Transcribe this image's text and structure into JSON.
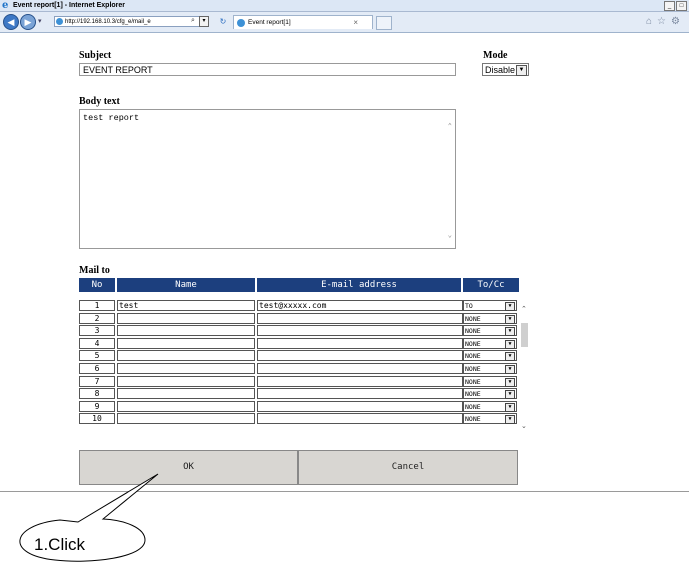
{
  "window": {
    "title": "Event report[1] - Internet Explorer",
    "address": "http://192.168.10.3/cfg_e/mail_e",
    "tab_label": "Event report[1]",
    "tab_close": "×"
  },
  "form": {
    "subject_label": "Subject",
    "subject_value": "EVENT REPORT",
    "mode_label": "Mode",
    "mode_value": "Disable",
    "body_label": "Body text",
    "body_value": "test report",
    "mail_to_label": "Mail to",
    "columns": [
      "No",
      "Name",
      "E-mail address",
      "To/Cc"
    ],
    "rows": [
      {
        "no": "1",
        "name": "test",
        "email": "test@xxxxx.com",
        "tocc": "TO"
      },
      {
        "no": "2",
        "name": "",
        "email": "",
        "tocc": "NONE"
      },
      {
        "no": "3",
        "name": "",
        "email": "",
        "tocc": "NONE"
      },
      {
        "no": "4",
        "name": "",
        "email": "",
        "tocc": "NONE"
      },
      {
        "no": "5",
        "name": "",
        "email": "",
        "tocc": "NONE"
      },
      {
        "no": "6",
        "name": "",
        "email": "",
        "tocc": "NONE"
      },
      {
        "no": "7",
        "name": "",
        "email": "",
        "tocc": "NONE"
      },
      {
        "no": "8",
        "name": "",
        "email": "",
        "tocc": "NONE"
      },
      {
        "no": "9",
        "name": "",
        "email": "",
        "tocc": "NONE"
      },
      {
        "no": "10",
        "name": "",
        "email": "",
        "tocc": "NONE"
      }
    ],
    "ok_label": "OK",
    "cancel_label": "Cancel"
  },
  "annotation": {
    "callout_label": "1.Click"
  },
  "colors": {
    "header_bg": "#1c3f7e",
    "button_bg": "#d8d6d2"
  }
}
